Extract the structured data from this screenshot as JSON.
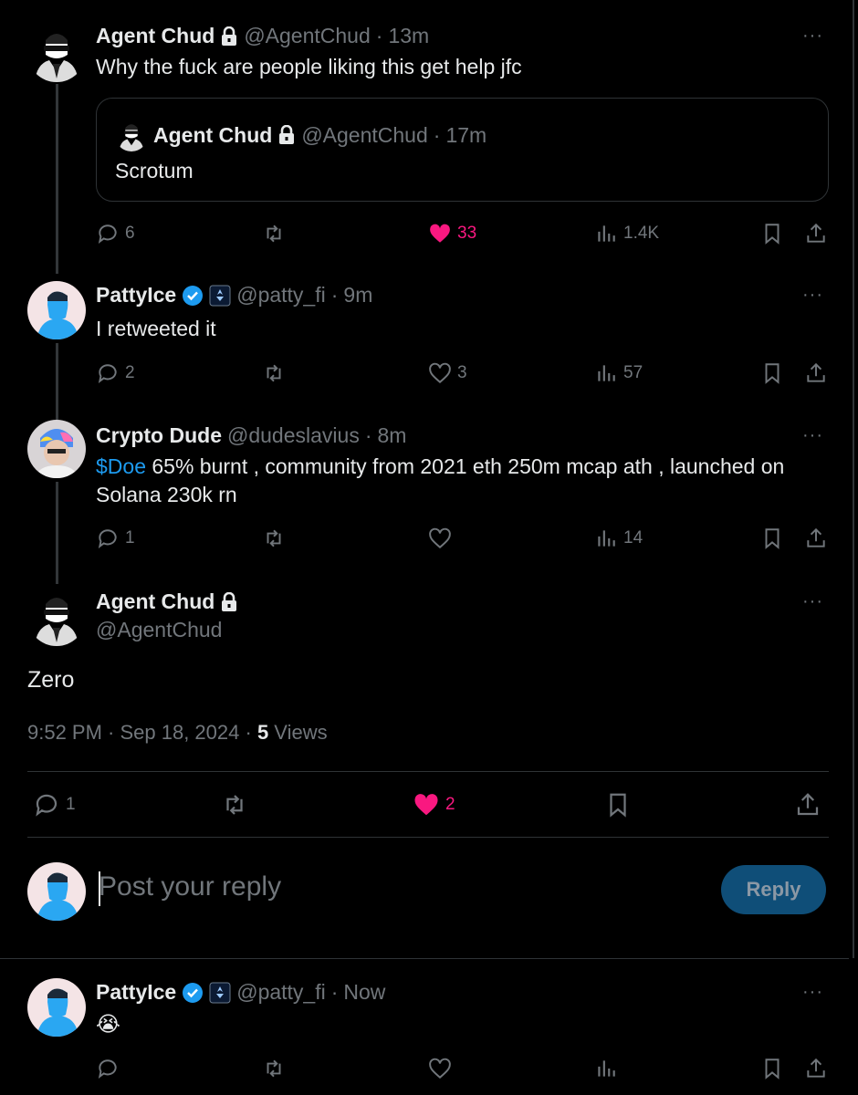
{
  "tweets": [
    {
      "name": "Agent Chud",
      "handle": "@AgentChud",
      "dot": "·",
      "time": "13m",
      "text": "Why the fuck are people liking this get help jfc",
      "quote": {
        "name": "Agent Chud",
        "handle": "@AgentChud",
        "dot": "·",
        "time": "17m",
        "text": "Scrotum"
      },
      "replies": "6",
      "retweets": "",
      "likes": "33",
      "views": "1.4K",
      "liked": true
    },
    {
      "name": "PattyIce",
      "handle": "@patty_fi",
      "dot": "·",
      "time": "9m",
      "text": "I retweeted it",
      "replies": "2",
      "retweets": "",
      "likes": "3",
      "views": "57",
      "liked": false
    },
    {
      "name": "Crypto Dude",
      "handle": "@dudeslavius",
      "dot": "·",
      "time": "8m",
      "cashtag": "$Doe",
      "text_line1": " 65% burnt , community from 2021 eth 250m mcap ath , launched on",
      "text_line2": "Solana 230k rn",
      "replies": "1",
      "retweets": "",
      "likes": "",
      "views": "14",
      "liked": false
    }
  ],
  "main": {
    "name": "Agent Chud",
    "handle": "@AgentChud",
    "text": "Zero",
    "time": "9:52 PM · Sep 18, 2024 · ",
    "views_count": "5",
    "views_label": " Views",
    "replies": "1",
    "likes": "2"
  },
  "composer": {
    "placeholder": "Post your reply",
    "button": "Reply"
  },
  "last_reply": {
    "name": "PattyIce",
    "handle": "@patty_fi",
    "dot": "·",
    "time": "Now",
    "text": "😭"
  },
  "more_label": "···",
  "colors": {
    "accent": "#1d9bf0",
    "like": "#f91880",
    "muted": "#71767b",
    "border": "#2f3336"
  }
}
